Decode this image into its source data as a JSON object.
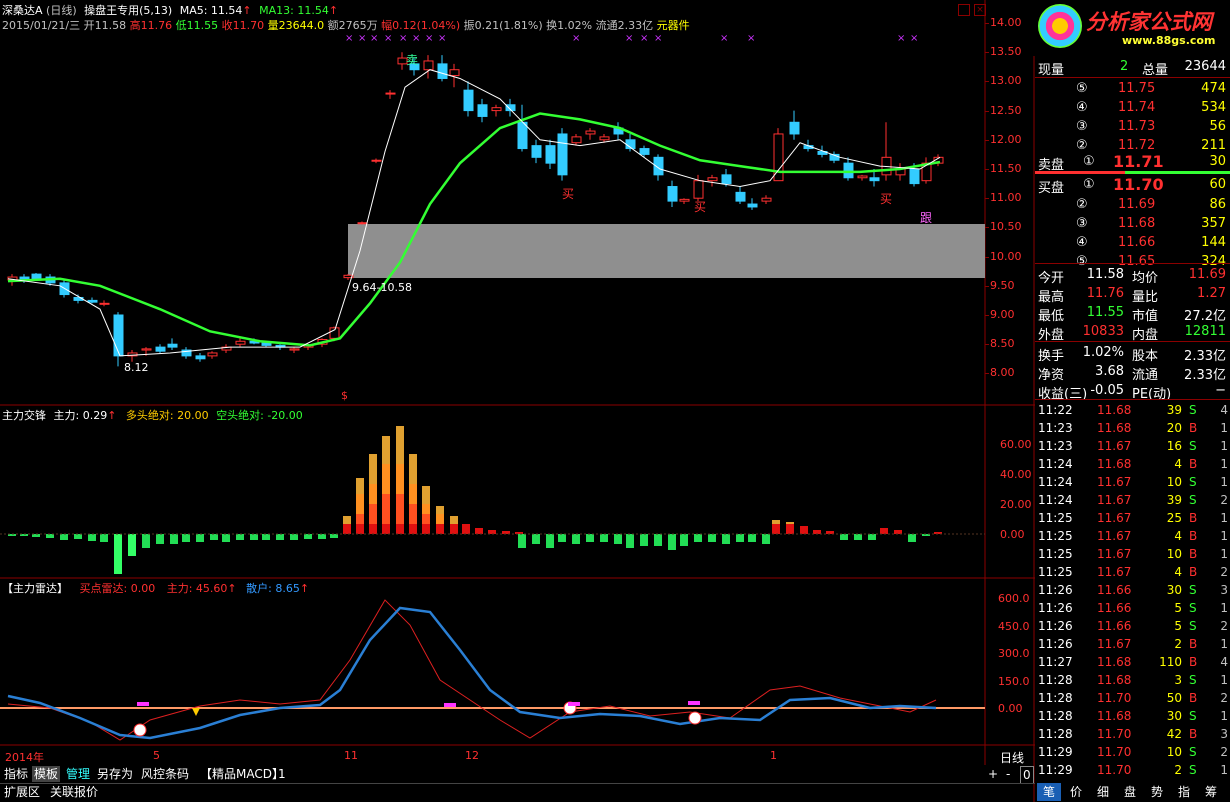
{
  "header": {
    "stock_name": "深桑达A",
    "period": "(日线)",
    "indicator_name": "操盘王专用(5,13)",
    "ma5_label": "MA5: 11.54",
    "ma13_label": "MA13: 11.54",
    "info_line": [
      "2015/01/21/三",
      "开11.58",
      "高11.76",
      "低11.55",
      "收11.70",
      "量23644.0",
      "额2765万",
      "幅0.12(1.04%)",
      "振0.21(1.81%)",
      "换1.02%",
      "流通2.33亿",
      "元器件"
    ]
  },
  "price_axis": [
    "14.00",
    "13.50",
    "13.00",
    "12.50",
    "12.00",
    "11.50",
    "11.00",
    "10.50",
    "10.00",
    "9.50",
    "9.00",
    "8.50",
    "8.00"
  ],
  "chart_annotations": {
    "range_label": "9.64-10.58",
    "low_label": "8.12",
    "signal_top": "卖",
    "buy_labels": [
      "买",
      "买",
      "买"
    ],
    "follow_label": "跟",
    "s_marker": "$"
  },
  "panel2": {
    "title": "主力交锋",
    "main_label": "主力: 0.29",
    "bull_label": "多头绝对: 20.00",
    "bear_label": "空头绝对: -20.00",
    "axis": [
      "60.00",
      "40.00",
      "20.00",
      "0.00"
    ]
  },
  "panel3": {
    "title": "【主力雷达】",
    "buy_radar": "买点雷达: 0.00",
    "main_force": "主力: 45.60",
    "retail": "散户: 8.65",
    "axis": [
      "600.0",
      "450.0",
      "300.0",
      "150.0",
      "0.00"
    ]
  },
  "time_axis": [
    "2014年",
    "5",
    "11",
    "12",
    "1"
  ],
  "period_label": "日线",
  "bottom_toolbar": {
    "items": [
      "指标",
      "模板",
      "管理",
      "另存为",
      "风控条码",
      "【精品MACD】",
      "1"
    ],
    "row2": [
      "扩展区",
      "关联报价"
    ],
    "zoom": [
      "+",
      "-",
      "0"
    ]
  },
  "quote": {
    "now_label": "现量",
    "now_val": "2",
    "total_label": "总量",
    "total_val": "23644",
    "asks": [
      {
        "lvl": "⑤",
        "price": "11.75",
        "vol": "474"
      },
      {
        "lvl": "④",
        "price": "11.74",
        "vol": "534"
      },
      {
        "lvl": "③",
        "price": "11.73",
        "vol": "56"
      },
      {
        "lvl": "②",
        "price": "11.72",
        "vol": "211"
      }
    ],
    "ask1": {
      "label": "卖盘",
      "lvl": "①",
      "price": "11.71",
      "vol": "30"
    },
    "bid1": {
      "label": "买盘",
      "lvl": "①",
      "price": "11.70",
      "vol": "60"
    },
    "bids": [
      {
        "lvl": "②",
        "price": "11.69",
        "vol": "86"
      },
      {
        "lvl": "③",
        "price": "11.68",
        "vol": "357"
      },
      {
        "lvl": "④",
        "price": "11.66",
        "vol": "144"
      },
      {
        "lvl": "⑤",
        "price": "11.65",
        "vol": "324"
      }
    ],
    "stats": [
      {
        "l1": "今开",
        "v1": "11.58",
        "l2": "均价",
        "v2": "11.69"
      },
      {
        "l1": "最高",
        "v1": "11.76",
        "l2": "量比",
        "v2": "1.27"
      },
      {
        "l1": "最低",
        "v1": "11.55",
        "l2": "市值",
        "v2": "27.2亿"
      },
      {
        "l1": "外盘",
        "v1": "10833",
        "l2": "内盘",
        "v2": "12811"
      }
    ],
    "stats2": [
      {
        "l1": "换手",
        "v1": "1.02%",
        "l2": "股本",
        "v2": "2.33亿"
      },
      {
        "l1": "净资",
        "v1": "3.68",
        "l2": "流通",
        "v2": "2.33亿"
      },
      {
        "l1": "收益(三)",
        "v1": "-0.05",
        "l2": "PE(动)",
        "v2": "−"
      }
    ]
  },
  "ticks": [
    {
      "t": "11:22",
      "p": "11.68",
      "v": "39",
      "d": "S",
      "n": "4"
    },
    {
      "t": "11:23",
      "p": "11.68",
      "v": "20",
      "d": "B",
      "n": "1"
    },
    {
      "t": "11:23",
      "p": "11.67",
      "v": "16",
      "d": "S",
      "n": "1"
    },
    {
      "t": "11:24",
      "p": "11.68",
      "v": "4",
      "d": "B",
      "n": "1"
    },
    {
      "t": "11:24",
      "p": "11.67",
      "v": "10",
      "d": "S",
      "n": "1"
    },
    {
      "t": "11:24",
      "p": "11.67",
      "v": "39",
      "d": "S",
      "n": "2"
    },
    {
      "t": "11:25",
      "p": "11.67",
      "v": "25",
      "d": "B",
      "n": "1"
    },
    {
      "t": "11:25",
      "p": "11.67",
      "v": "4",
      "d": "B",
      "n": "1"
    },
    {
      "t": "11:25",
      "p": "11.67",
      "v": "10",
      "d": "B",
      "n": "1"
    },
    {
      "t": "11:25",
      "p": "11.67",
      "v": "4",
      "d": "B",
      "n": "2"
    },
    {
      "t": "11:26",
      "p": "11.66",
      "v": "30",
      "d": "S",
      "n": "3"
    },
    {
      "t": "11:26",
      "p": "11.66",
      "v": "5",
      "d": "S",
      "n": "1"
    },
    {
      "t": "11:26",
      "p": "11.66",
      "v": "5",
      "d": "S",
      "n": "2"
    },
    {
      "t": "11:26",
      "p": "11.67",
      "v": "2",
      "d": "B",
      "n": "1"
    },
    {
      "t": "11:27",
      "p": "11.68",
      "v": "110",
      "d": "B",
      "n": "4"
    },
    {
      "t": "11:28",
      "p": "11.68",
      "v": "3",
      "d": "S",
      "n": "1"
    },
    {
      "t": "11:28",
      "p": "11.70",
      "v": "50",
      "d": "B",
      "n": "2"
    },
    {
      "t": "11:28",
      "p": "11.68",
      "v": "30",
      "d": "S",
      "n": "1"
    },
    {
      "t": "11:28",
      "p": "11.70",
      "v": "42",
      "d": "B",
      "n": "3"
    },
    {
      "t": "11:29",
      "p": "11.70",
      "v": "10",
      "d": "S",
      "n": "2"
    },
    {
      "t": "11:29",
      "p": "11.70",
      "v": "2",
      "d": "S",
      "n": "1"
    }
  ],
  "right_tabs": [
    "笔",
    "价",
    "细",
    "盘",
    "势",
    "指",
    "筹"
  ],
  "logo": {
    "text": "分析家公式网",
    "url_text": "www.88gs.com"
  }
}
